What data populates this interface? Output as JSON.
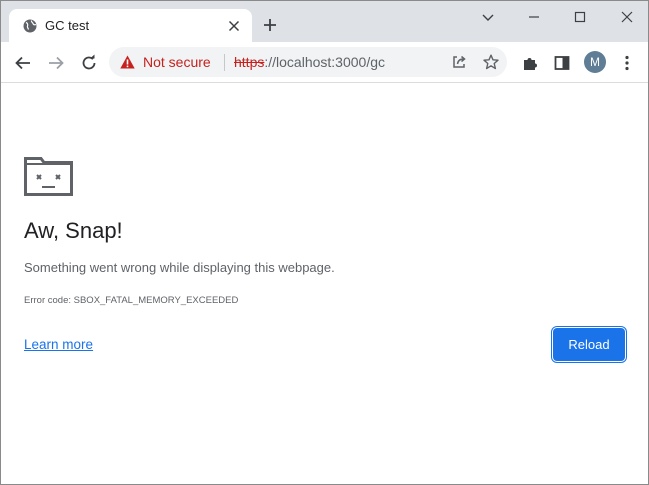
{
  "tab": {
    "title": "GC test",
    "favicon": "globe-icon"
  },
  "toolbar": {
    "security_label": "Not secure",
    "url_scheme": "https",
    "url_rest": "://localhost:3000/gc",
    "avatar_initial": "M"
  },
  "error_page": {
    "icon": "sad-folder-icon",
    "heading": "Aw, Snap!",
    "message": "Something went wrong while displaying this webpage.",
    "error_code": "Error code: SBOX_FATAL_MEMORY_EXCEEDED",
    "learn_more": "Learn more",
    "reload": "Reload"
  },
  "colors": {
    "accent": "#1a73e8",
    "warning": "#c5221f",
    "tabstrip": "#dee1e6"
  }
}
